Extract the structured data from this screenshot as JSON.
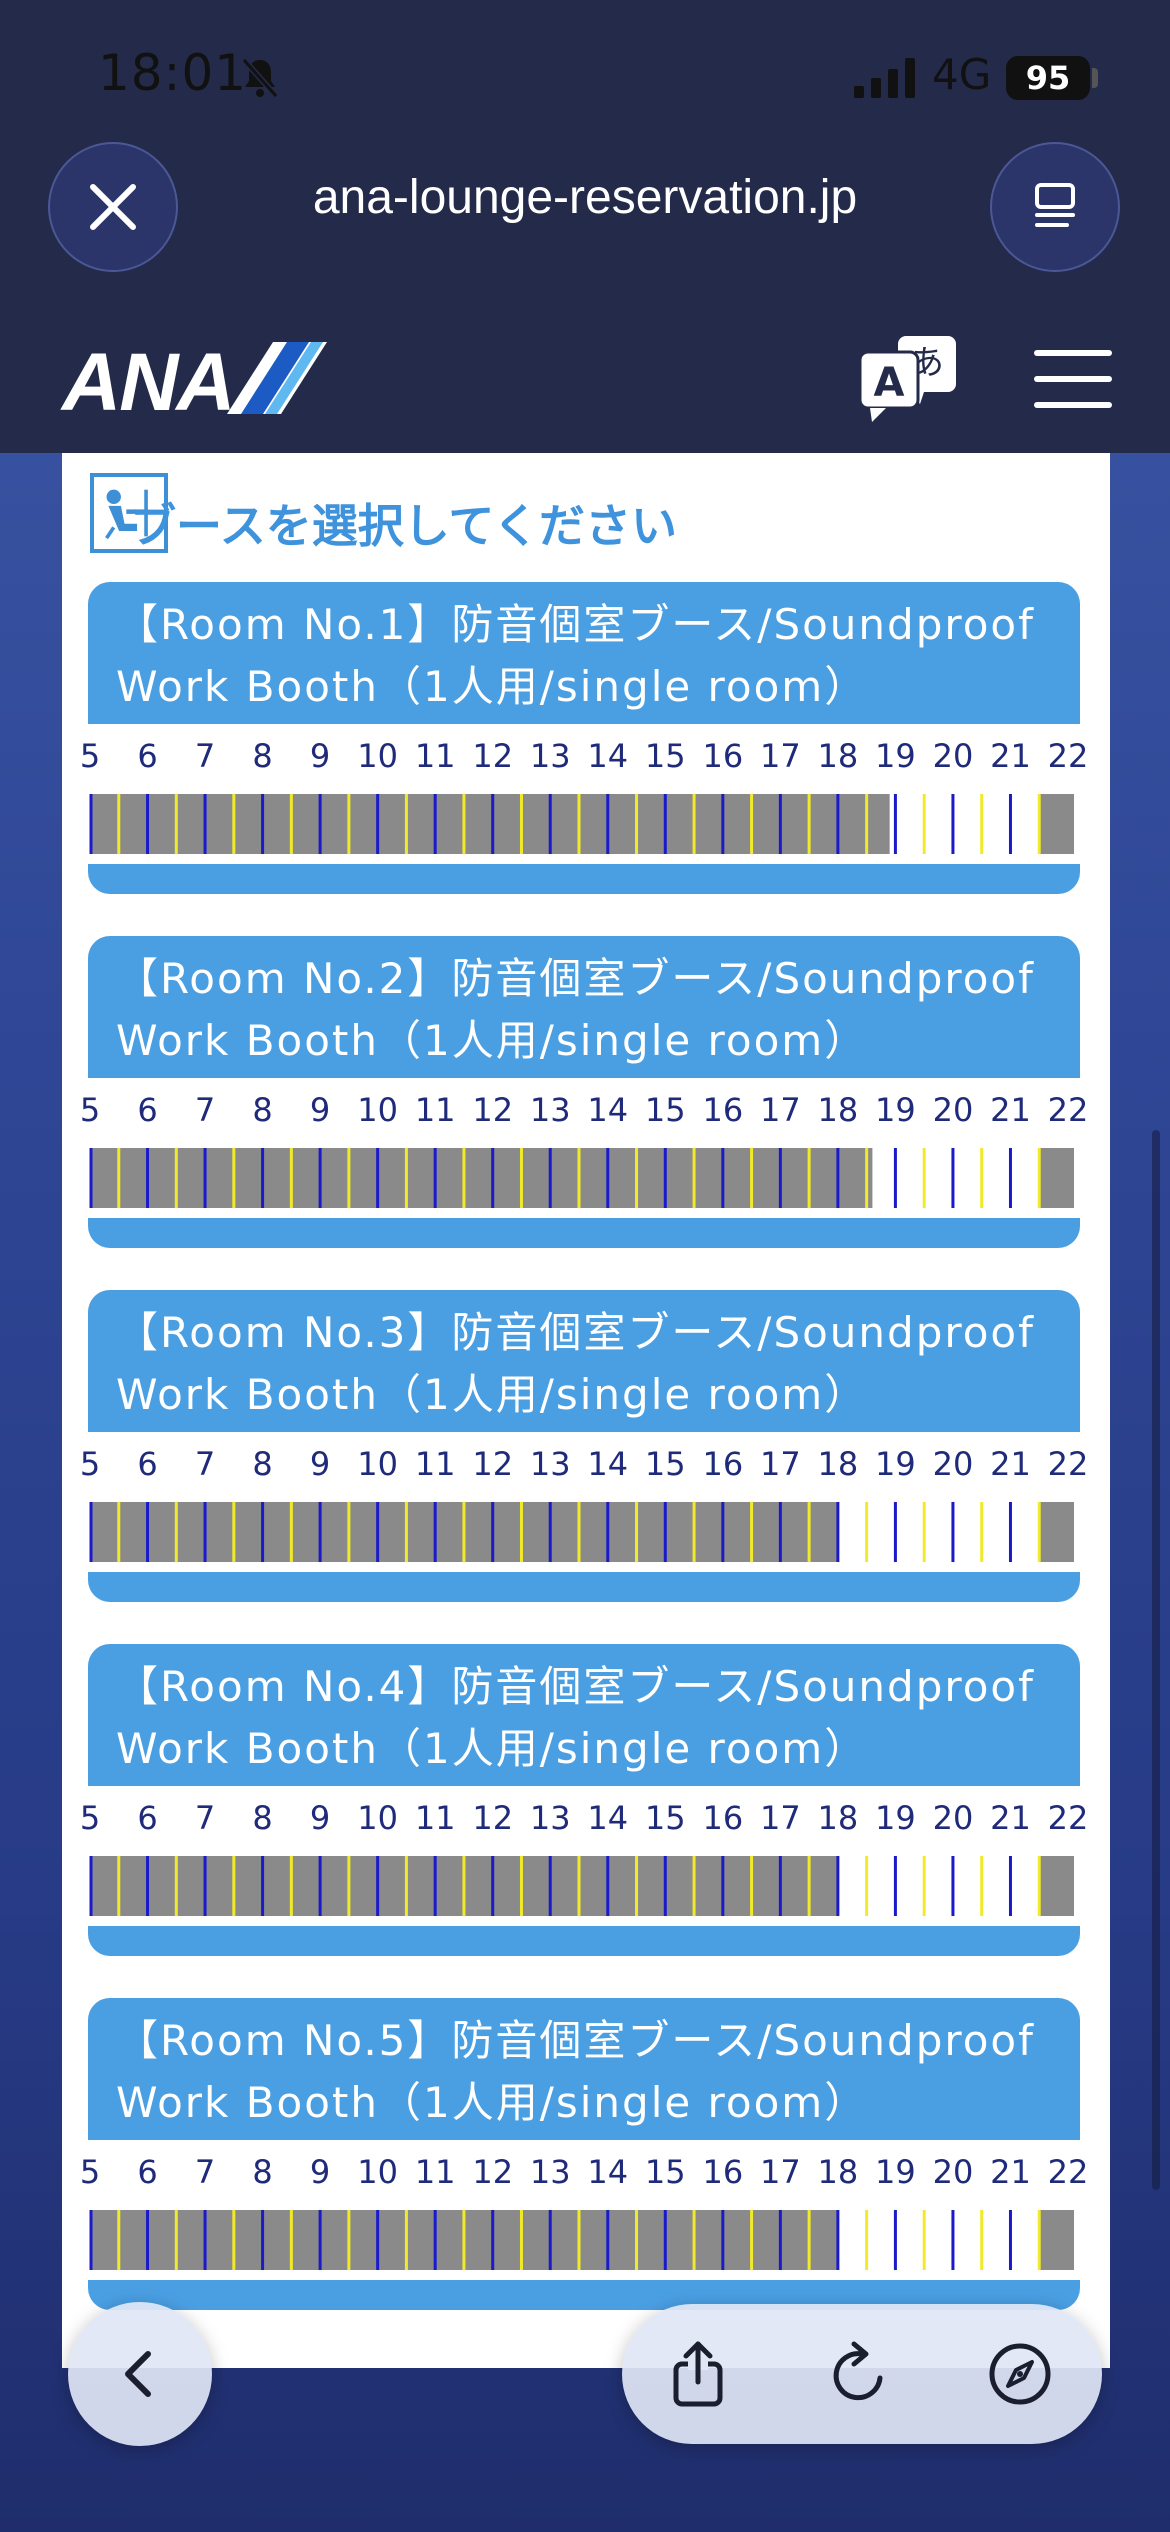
{
  "status_bar": {
    "time": "18:01",
    "network": "4G",
    "battery": "95"
  },
  "browser": {
    "url": "ana-lounge-reservation.jp"
  },
  "header": {
    "logo_text": "ANA"
  },
  "page": {
    "section_title": "ブースを選択してください"
  },
  "hour_labels": [
    "5",
    "6",
    "7",
    "8",
    "9",
    "10",
    "11",
    "12",
    "13",
    "14",
    "15",
    "16",
    "17",
    "18",
    "19",
    "20",
    "21",
    "22"
  ],
  "colors": {
    "booked": "#8a8a8a",
    "blue_line": "#1a1acb",
    "yellow_line": "#f1ea2a",
    "header_blue": "#4a9fe3"
  },
  "rooms": [
    {
      "line1": "【Room No.1】防音個室ブース/Soundproof",
      "line2": "Work Booth（1人用/single room）",
      "booked_until_hour": 18.9,
      "booked_from_hour": 21.5
    },
    {
      "line1": "【Room No.2】防音個室ブース/Soundproof",
      "line2": "Work Booth（1人用/single room）",
      "booked_until_hour": 18.6,
      "booked_from_hour": 21.5
    },
    {
      "line1": "【Room No.3】防音個室ブース/Soundproof",
      "line2": "Work Booth（1人用/single room）",
      "booked_until_hour": 18.0,
      "booked_from_hour": 21.5
    },
    {
      "line1": "【Room No.4】防音個室ブース/Soundproof",
      "line2": "Work Booth（1人用/single room）",
      "booked_until_hour": 18.0,
      "booked_from_hour": 21.5
    },
    {
      "line1": "【Room No.5】防音個室ブース/Soundproof",
      "line2": "Work Booth（1人用/single room）",
      "booked_until_hour": 18.0,
      "booked_from_hour": 21.5
    }
  ]
}
